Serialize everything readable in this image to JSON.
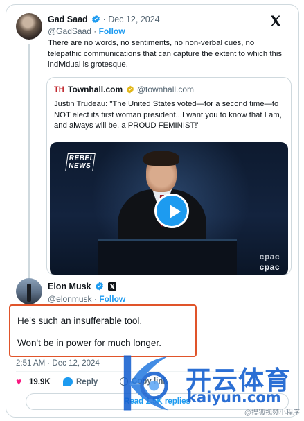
{
  "tweet1": {
    "name": "Gad Saad",
    "date": "· Dec 12, 2024",
    "handle": "@GadSaad",
    "separator": "·",
    "follow": "Follow",
    "text": "There are no words, no sentiments, no non-verbal cues, no telepathic communications that can capture the extent to which this individual is grotesque."
  },
  "quote": {
    "logo": "TH",
    "name": "Townhall.com",
    "handle": "@townhall.com",
    "text": "Justin Trudeau: \"The United States voted—for a second time—to NOT elect its first woman president...I want you to know that I am, and always will be, a PROUD FEMINIST!\"",
    "video": {
      "overlay_top": "REBEL NEWS",
      "watermark_1": "cpac",
      "watermark_2": "cpac"
    }
  },
  "tweet2": {
    "name": "Elon Musk",
    "handle": "@elonmusk",
    "separator": "·",
    "follow": "Follow",
    "line1": "He's such an insufferable tool.",
    "line2": "Won't be in power for much longer.",
    "timestamp": "2:51 AM · Dec 12, 2024",
    "likes": "19.9K",
    "reply": "Reply",
    "copy": "Copy link",
    "read": "Read 1.5K replies"
  },
  "watermark": {
    "brand": "开云体育",
    "url": "kaiyun.com",
    "small": "@搜狐视频小程序"
  },
  "colors": {
    "accent": "#1d9bf0",
    "like": "#f91880",
    "highlight_box": "#e0542a",
    "watermark": "#1560d0"
  },
  "icons": [
    "verified-badge-icon",
    "x-logo-icon",
    "gold-verified-badge-icon",
    "play-icon",
    "x-affiliate-badge-icon",
    "heart-icon",
    "reply-icon",
    "copy-link-icon"
  ]
}
